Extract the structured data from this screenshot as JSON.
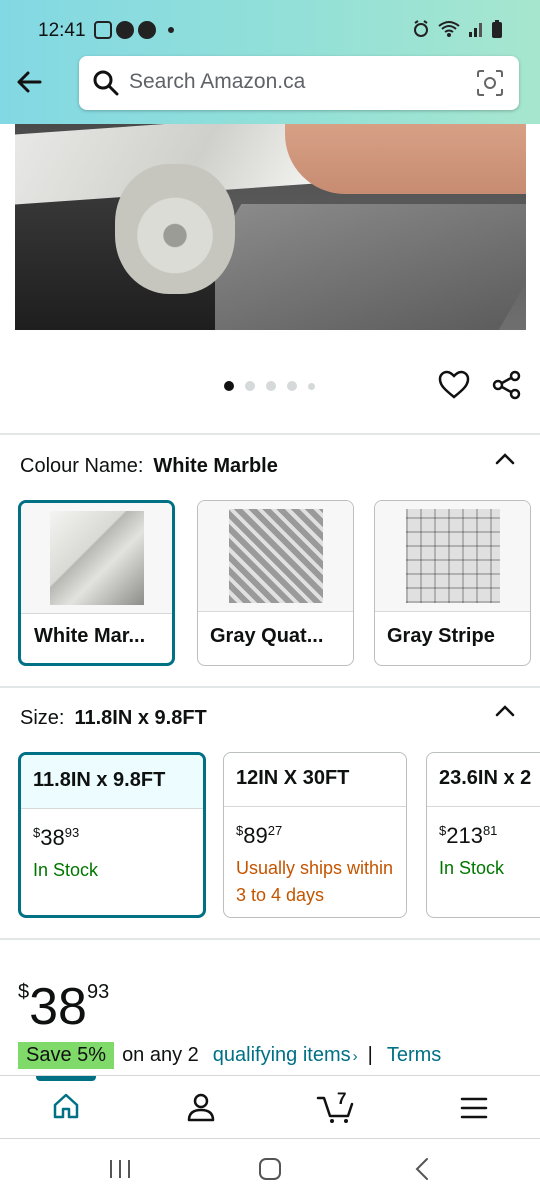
{
  "status_bar": {
    "time": "12:41"
  },
  "search": {
    "placeholder": "Search Amazon.ca"
  },
  "image_carousel": {
    "total": 5,
    "active": 1
  },
  "colour": {
    "label": "Colour Name:",
    "selected": "White Marble",
    "options": [
      {
        "name": "White Mar..."
      },
      {
        "name": "Gray Quat..."
      },
      {
        "name": "Gray Stripe"
      }
    ]
  },
  "size": {
    "label": "Size:",
    "selected": "11.8IN x 9.8FT",
    "options": [
      {
        "name": "11.8IN x 9.8FT",
        "currency": "$",
        "dollars": "38",
        "cents": "93",
        "availability": "In Stock"
      },
      {
        "name": "12IN X 30FT",
        "currency": "$",
        "dollars": "89",
        "cents": "27",
        "availability": "Usually ships within 3 to 4 days"
      },
      {
        "name": "23.6IN x 2",
        "currency": "$",
        "dollars": "213",
        "cents": "81",
        "availability": "In Stock"
      }
    ]
  },
  "price": {
    "currency": "$",
    "dollars": "38",
    "cents": "93"
  },
  "promo": {
    "badge": "Save 5%",
    "text": "on any 2",
    "link": "qualifying items",
    "link_chevron": "›",
    "separator": "|",
    "terms": "Terms"
  },
  "bottom_nav": {
    "items": [
      "home-icon",
      "account-icon",
      "cart-icon",
      "menu-icon"
    ],
    "cart_count": "7"
  },
  "colors": {
    "accent": "#007185",
    "in_stock": "#007600",
    "ships_later": "#c45500",
    "save_badge": "#7fda69"
  }
}
